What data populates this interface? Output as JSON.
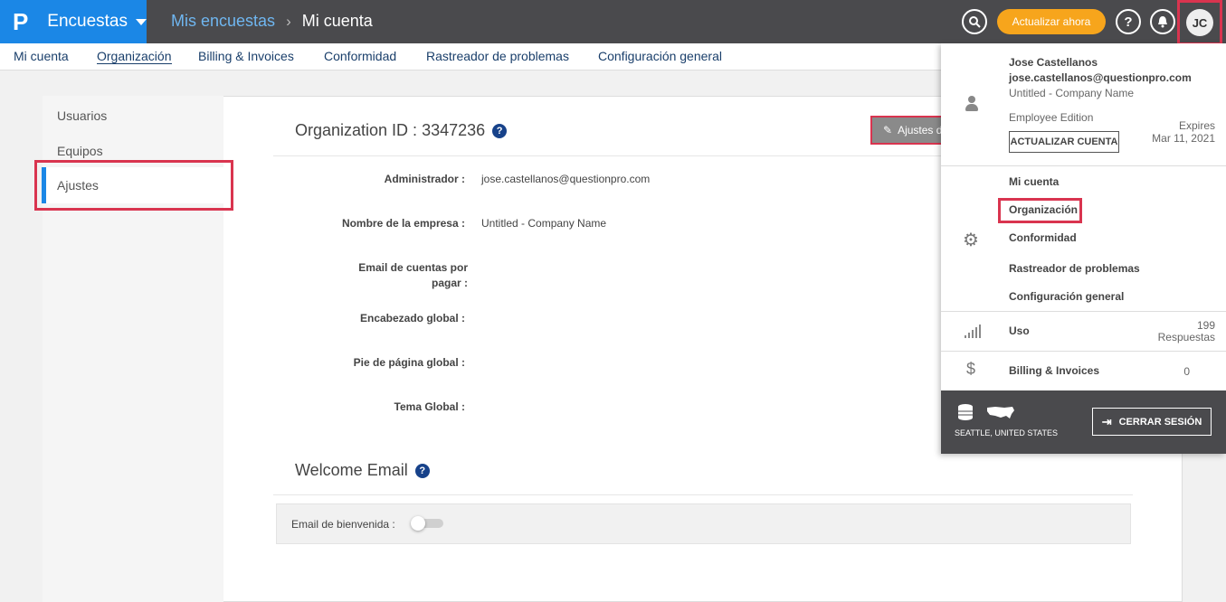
{
  "topbar": {
    "brand_logo": "P",
    "brand_name": "Encuestas",
    "crumb_1": "Mis encuestas",
    "crumb_sep": "›",
    "crumb_2": "Mi cuenta",
    "upgrade_label": "Actualizar ahora",
    "help_glyph": "?",
    "avatar_initials": "JC",
    "brand_color": "#1b87e6",
    "upgrade_color": "#f7a51c"
  },
  "subnav": {
    "items": [
      "Mi cuenta",
      "Organización",
      "Billing & Invoices",
      "Conformidad",
      "Rastreador de problemas",
      "Configuración general"
    ],
    "active": "Organización"
  },
  "leftnav": {
    "items": [
      "Usuarios",
      "Equipos",
      "Ajustes"
    ],
    "selected": "Ajustes"
  },
  "org": {
    "title": "Organization ID : 3347236",
    "settings_button": "Ajustes d",
    "fields": [
      {
        "label": "Administrador :",
        "value": "jose.castellanos@questionpro.com"
      },
      {
        "label": "Nombre de la empresa :",
        "value": "Untitled - Company Name"
      },
      {
        "label": "Email de cuentas por pagar :",
        "value": ""
      },
      {
        "label": "Encabezado global :",
        "value": ""
      },
      {
        "label": "Pie de página global :",
        "value": ""
      },
      {
        "label": "Tema Global :",
        "value": ""
      }
    ]
  },
  "welcome": {
    "title": "Welcome Email",
    "toggle_label": "Email de bienvenida :",
    "toggle_on": false
  },
  "dropdown": {
    "user_name": "Jose Castellanos",
    "user_email": "jose.castellanos@questionpro.com",
    "company": "Untitled - Company Name",
    "edition": "Employee Edition",
    "upgrade_account": "ACTUALIZAR CUENTA",
    "expires_label": "Expires",
    "expires_date": "Mar 11, 2021",
    "links": [
      "Mi cuenta",
      "Organización",
      "Conformidad",
      "Rastreador de problemas",
      "Configuración general"
    ],
    "usage_label": "Uso",
    "usage_count": "199",
    "usage_unit": "Respuestas",
    "billing_label": "Billing & Invoices",
    "billing_count": "0",
    "location": "SEATTLE, UNITED STATES",
    "logout": "CERRAR SESIÓN"
  }
}
